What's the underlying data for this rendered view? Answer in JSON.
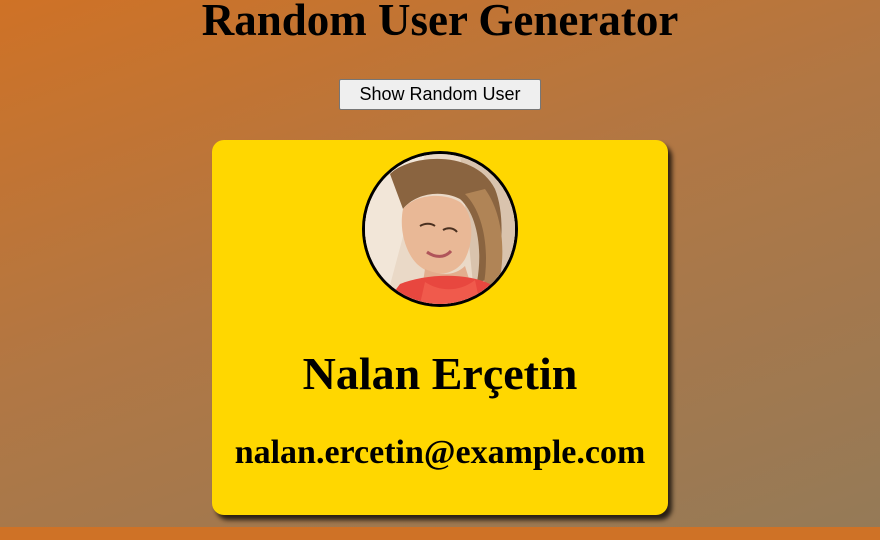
{
  "page": {
    "title": "Random User Generator"
  },
  "controls": {
    "show_button_label": "Show Random User"
  },
  "user": {
    "name": "Nalan Erçetin",
    "email": "nalan.ercetin@example.com",
    "photo_alt": "Photo of Nalan Erçetin"
  },
  "colors": {
    "card_background": "#ffd700",
    "background_start": "#cf7226",
    "background_end": "#947a58",
    "button_background": "#efefef"
  }
}
